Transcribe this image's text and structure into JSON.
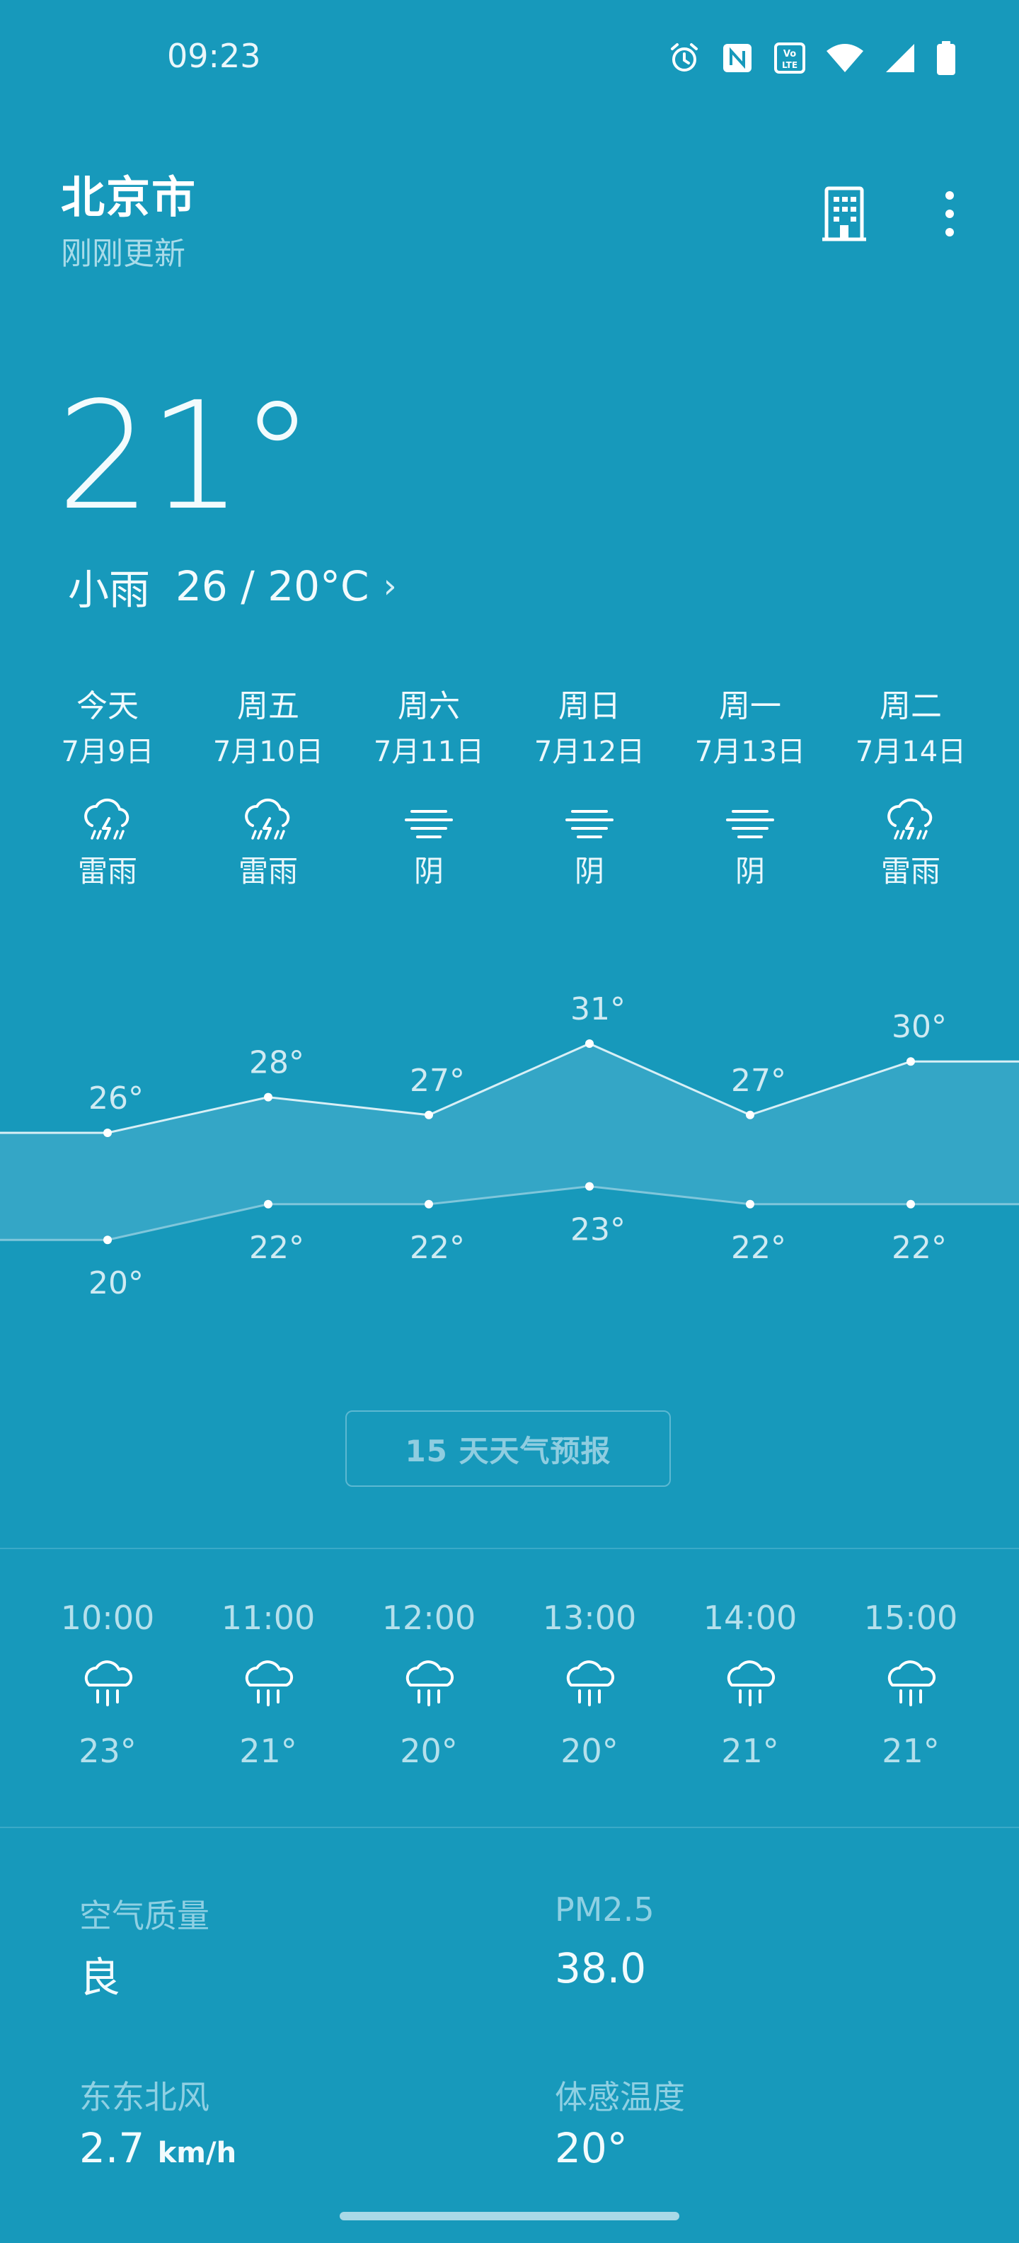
{
  "status_bar": {
    "time": "09:23",
    "icons": [
      "alarm-icon",
      "nfc-icon",
      "volte-icon",
      "wifi-icon",
      "signal-icon",
      "battery-icon"
    ]
  },
  "header": {
    "city": "北京市",
    "updated": "刚刚更新"
  },
  "current": {
    "temp": "21°",
    "condition": "小雨",
    "range": "26 / 20°C",
    "chevron": "›"
  },
  "daily": [
    {
      "day": "今天",
      "date": "7月9日",
      "icon": "thunderstorm-icon",
      "condition": "雷雨",
      "high": 26,
      "low": 20,
      "high_label": "26°",
      "low_label": "20°"
    },
    {
      "day": "周五",
      "date": "7月10日",
      "icon": "thunderstorm-icon",
      "condition": "雷雨",
      "high": 28,
      "low": 22,
      "high_label": "28°",
      "low_label": "22°"
    },
    {
      "day": "周六",
      "date": "7月11日",
      "icon": "overcast-icon",
      "condition": "阴",
      "high": 27,
      "low": 22,
      "high_label": "27°",
      "low_label": "22°"
    },
    {
      "day": "周日",
      "date": "7月12日",
      "icon": "overcast-icon",
      "condition": "阴",
      "high": 31,
      "low": 23,
      "high_label": "31°",
      "low_label": "23°"
    },
    {
      "day": "周一",
      "date": "7月13日",
      "icon": "overcast-icon",
      "condition": "阴",
      "high": 27,
      "low": 22,
      "high_label": "27°",
      "low_label": "22°"
    },
    {
      "day": "周二",
      "date": "7月14日",
      "icon": "thunderstorm-icon",
      "condition": "雷雨",
      "high": 30,
      "low": 22,
      "high_label": "30°",
      "low_label": "22°"
    }
  ],
  "chart_data": {
    "type": "area",
    "categories": [
      "今天",
      "周五",
      "周六",
      "周日",
      "周一",
      "周二"
    ],
    "series": [
      {
        "values": [
          26,
          28,
          27,
          31,
          27,
          30
        ]
      },
      {
        "values": [
          20,
          22,
          22,
          23,
          22,
          22
        ]
      }
    ]
  },
  "forecast_button": "15 天天气预报",
  "hourly": [
    {
      "time": "10:00",
      "icon": "rain-icon",
      "temp": "23°"
    },
    {
      "time": "11:00",
      "icon": "rain-icon",
      "temp": "21°"
    },
    {
      "time": "12:00",
      "icon": "rain-icon",
      "temp": "20°"
    },
    {
      "time": "13:00",
      "icon": "rain-icon",
      "temp": "20°"
    },
    {
      "time": "14:00",
      "icon": "rain-icon",
      "temp": "21°"
    },
    {
      "time": "15:00",
      "icon": "rain-icon",
      "temp": "21°"
    }
  ],
  "details": {
    "air_quality": {
      "label": "空气质量",
      "value": "良"
    },
    "pm25": {
      "label": "PM2.5",
      "value": "38.0"
    },
    "wind": {
      "label": "东东北风",
      "value": "2.7",
      "unit": "km/h"
    },
    "feels_like": {
      "label": "体感温度",
      "value": "20°"
    }
  },
  "colors": {
    "background": "#1799bb",
    "band": "#3aa8c8",
    "line": "#d8eff6"
  }
}
